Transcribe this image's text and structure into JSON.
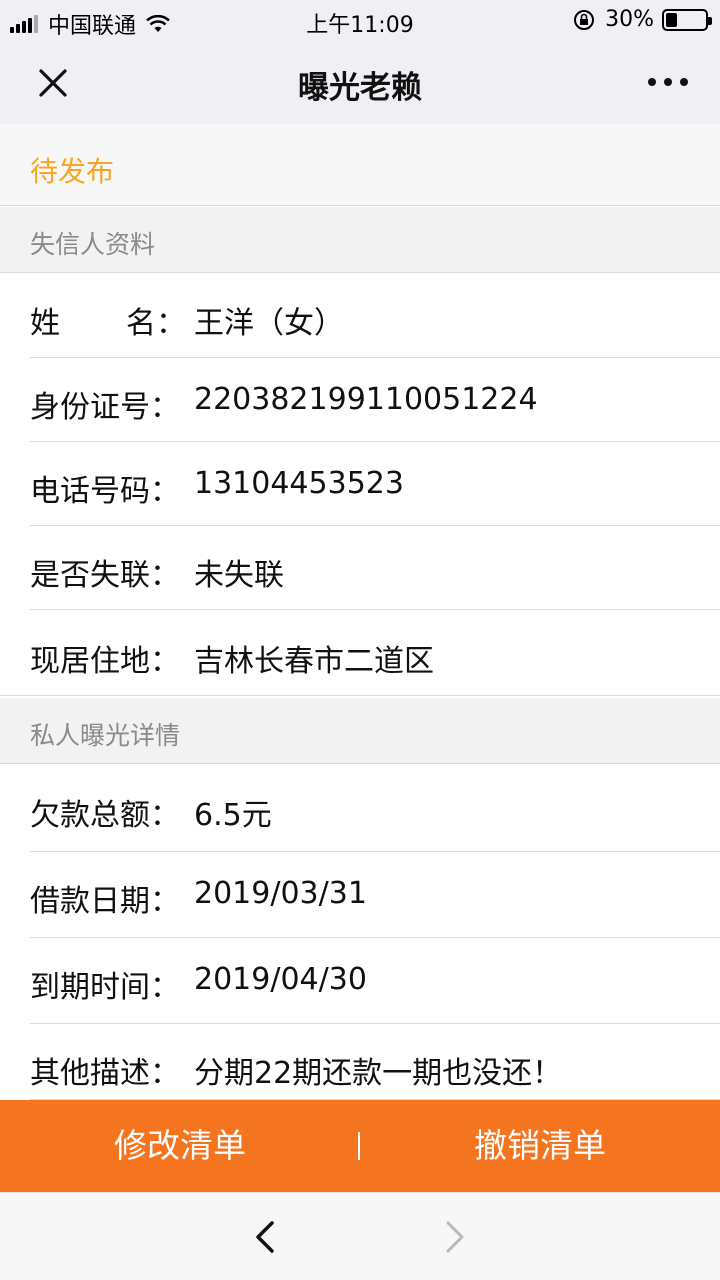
{
  "status_bar": {
    "carrier": "中国联通",
    "time": "上午11:09",
    "battery_percent": "30%",
    "battery_level": 0.3
  },
  "nav": {
    "title": "曝光老赖"
  },
  "status": {
    "label": "待发布"
  },
  "sections": {
    "profile_header": "失信人资料",
    "exposure_header": "私人曝光详情"
  },
  "profile": {
    "name_label_1": "姓",
    "name_label_2": "名：",
    "name_value": "王洋（女）",
    "id_label": "身份证号：",
    "id_value": "220382199110051224",
    "phone_label": "电话号码：",
    "phone_value": "13104453523",
    "lost_label": "是否失联：",
    "lost_value": "未失联",
    "address_label": "现居住地：",
    "address_value": "吉林长春市二道区"
  },
  "exposure": {
    "amount_label": "欠款总额：",
    "amount_value": "6.5元",
    "loan_date_label": "借款日期：",
    "loan_date_value": "2019/03/31",
    "due_date_label": "到期时间：",
    "due_date_value": "2019/04/30",
    "desc_label": "其他描述：",
    "desc_value": "分期22期还款一期也没还！"
  },
  "actions": {
    "edit_label": "修改清单",
    "divider": "|",
    "revoke_label": "撤销清单"
  },
  "colors": {
    "accent": "#f4741f",
    "status_pending": "#f5a623"
  }
}
